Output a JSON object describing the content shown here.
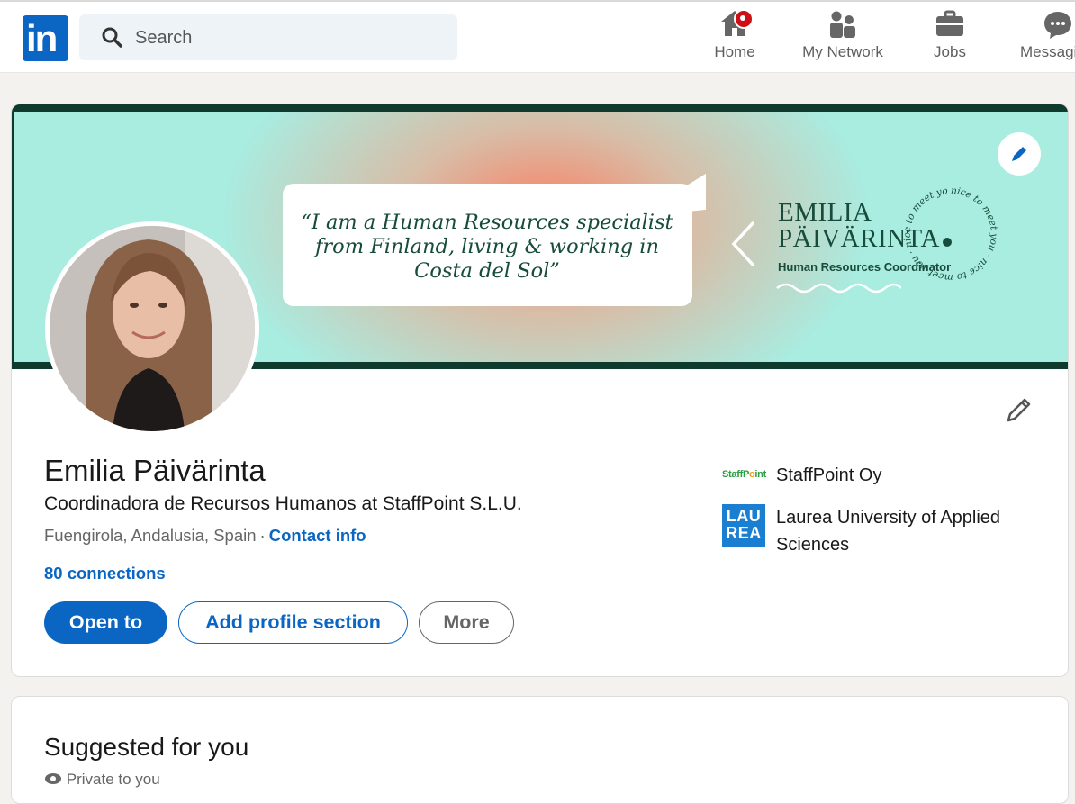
{
  "nav": {
    "search_placeholder": "Search",
    "items": [
      {
        "label": "Home",
        "icon": "home-icon"
      },
      {
        "label": "My Network",
        "icon": "network-icon"
      },
      {
        "label": "Jobs",
        "icon": "briefcase-icon"
      },
      {
        "label": "Messaging",
        "icon": "messaging-icon"
      }
    ],
    "logo_text": "in"
  },
  "banner": {
    "quote": "“I am a Human Resources specialist from Finland, living & working in Costa del Sol”",
    "name_line1": "EMILIA",
    "name_line2": "PÄIVÄRINTA",
    "role": "Human Resources Coordinator",
    "ring_text": "nice to meet you · nice to meet you · nice to meet you ·"
  },
  "profile": {
    "name": "Emilia Päivärinta",
    "headline": "Coordinadora de Recursos Humanos at StaffPoint S.L.U.",
    "location": "Fuengirola, Andalusia, Spain",
    "separator": "·",
    "contact_info": "Contact info",
    "connections": "80 connections",
    "buttons": {
      "open_to": "Open to",
      "add_section": "Add profile section",
      "more": "More"
    },
    "organizations": [
      {
        "name": "StaffPoint Oy",
        "logo_text": "StaffPoint"
      },
      {
        "name": "Laurea University of Applied Sciences",
        "logo_line1": "LAU",
        "logo_line2": "REA"
      }
    ]
  },
  "suggested": {
    "title": "Suggested for you",
    "subtitle": "Private to you"
  },
  "colors": {
    "brand": "#0a66c2",
    "page_bg": "#f3f2ef",
    "banner_mint": "#a9ece0",
    "banner_dark": "#0f3b2e",
    "notification": "#cc1016"
  }
}
